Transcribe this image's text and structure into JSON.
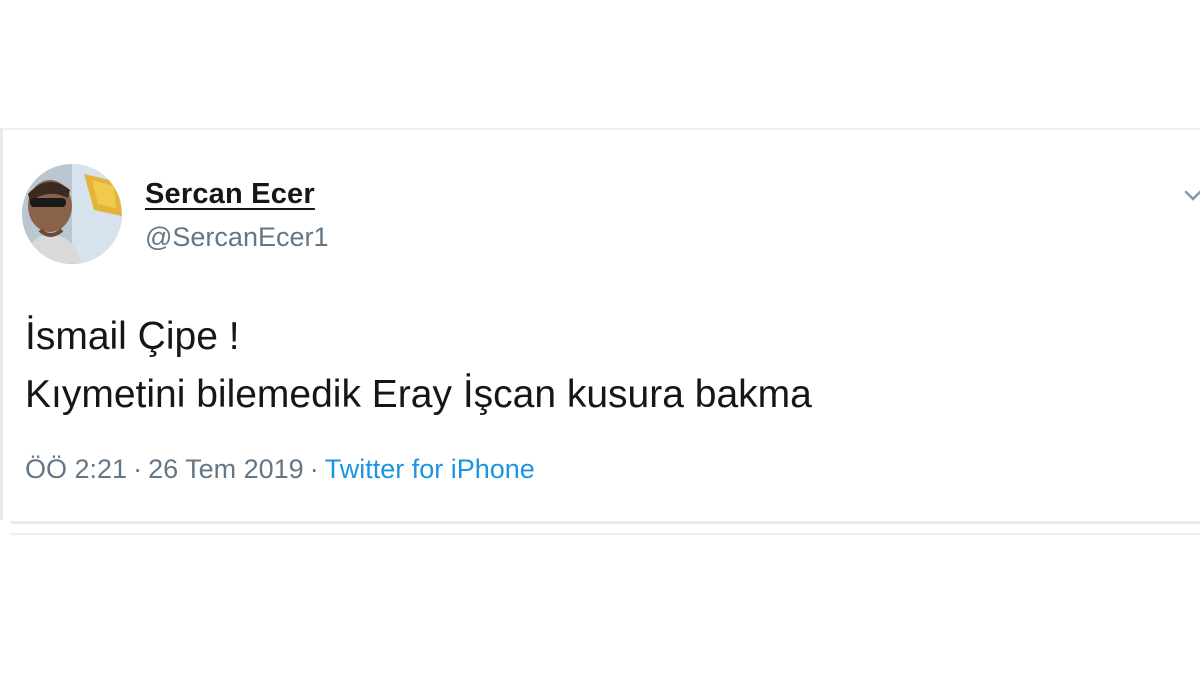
{
  "tweet": {
    "author": {
      "name": "Sercan Ecer",
      "handle": "@SercanEcer1",
      "avatar_icon": "profile-photo"
    },
    "text_lines": [
      "İsmail Çipe !",
      "Kıymetini bilemedik Eray İşcan kusura bakma"
    ],
    "time": "ÖÖ 2:21",
    "date": "26 Tem 2019",
    "separator": "·",
    "source": "Twitter for iPhone",
    "menu_icon": "chevron-down-icon"
  },
  "colors": {
    "text": "#14171a",
    "secondary": "#657786",
    "link": "#1b95e0"
  }
}
